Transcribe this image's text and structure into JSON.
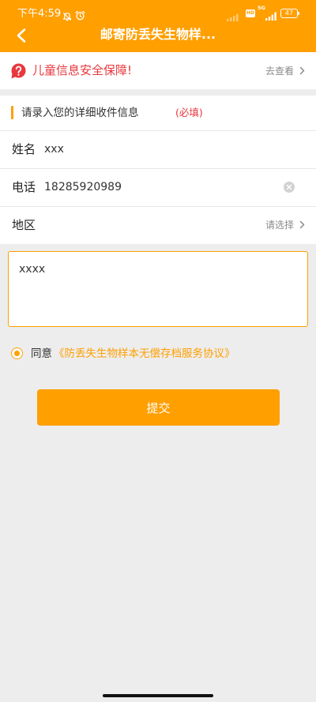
{
  "status_bar": {
    "time": "下午4:59",
    "hd": "HD",
    "network": "5G",
    "battery": "47",
    "icons": [
      "mute-icon",
      "alarm-icon",
      "signal-icon",
      "battery-icon"
    ]
  },
  "header": {
    "title": "邮寄防丢失生物样...",
    "back_icon": "chevron-left-icon"
  },
  "notice": {
    "icon": "question-bubble-icon",
    "text": "儿童信息安全保障!",
    "link": "去查看"
  },
  "section": {
    "title": "请录入您的详细收件信息",
    "required": "(必填)"
  },
  "form": {
    "name": {
      "label": "姓名",
      "value": "xxx"
    },
    "phone": {
      "label": "电话",
      "value": "18285920989"
    },
    "region": {
      "label": "地区",
      "placeholder": "请选择"
    },
    "address": {
      "value": "xxxx"
    }
  },
  "agreement": {
    "checked": true,
    "prefix": "同意",
    "link": "《防丢失生物样本无偿存档服务协议》"
  },
  "submit": {
    "label": "提交"
  },
  "colors": {
    "accent": "#ff9f00",
    "danger": "#e8373d",
    "background": "#ededed"
  }
}
